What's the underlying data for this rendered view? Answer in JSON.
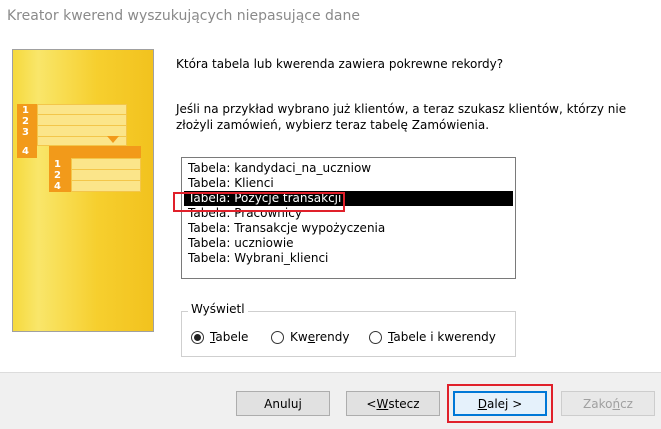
{
  "window": {
    "title": "Kreator kwerend wyszukujących niepasujące dane"
  },
  "question": "Która tabela lub kwerenda zawiera pokrewne rekordy?",
  "hint": "Jeśli na przykład wybrano już klientów, a teraz szukasz klientów, którzy nie złożyli zamówień, wybierz teraz tabelę Zamówienia.",
  "illustration": {
    "top_numbers": [
      "1",
      "2",
      "3",
      "4"
    ],
    "bottom_numbers": [
      "1",
      "2",
      "4"
    ]
  },
  "list": {
    "items": [
      "Tabela: kandydaci_na_uczniow",
      "Tabela: Klienci",
      "Tabela: Pozycje transakcji",
      "Tabela: Pracownicy",
      "Tabela: Transakcje wypożyczenia",
      "Tabela: uczniowie",
      "Tabela: Wybrani_klienci"
    ],
    "selected_index": 2
  },
  "view_group": {
    "label": "Wyświetl",
    "options": [
      {
        "pre": "",
        "key": "T",
        "post": "abele",
        "checked": true
      },
      {
        "pre": "Kw",
        "key": "e",
        "post": "rendy",
        "checked": false
      },
      {
        "pre": "",
        "key": "T",
        "post": "abele i kwerendy",
        "checked": false
      }
    ]
  },
  "buttons": {
    "cancel": "Anuluj",
    "back": {
      "pre": "< ",
      "key": "W",
      "post": "stecz"
    },
    "next": {
      "pre": "",
      "key": "D",
      "post": "alej >"
    },
    "finish": {
      "pre": "Zako",
      "key": "ń",
      "post": "cz"
    }
  },
  "colors": {
    "selection": "#000000",
    "highlight": "#e0202a",
    "primary_border": "#0078d7"
  }
}
